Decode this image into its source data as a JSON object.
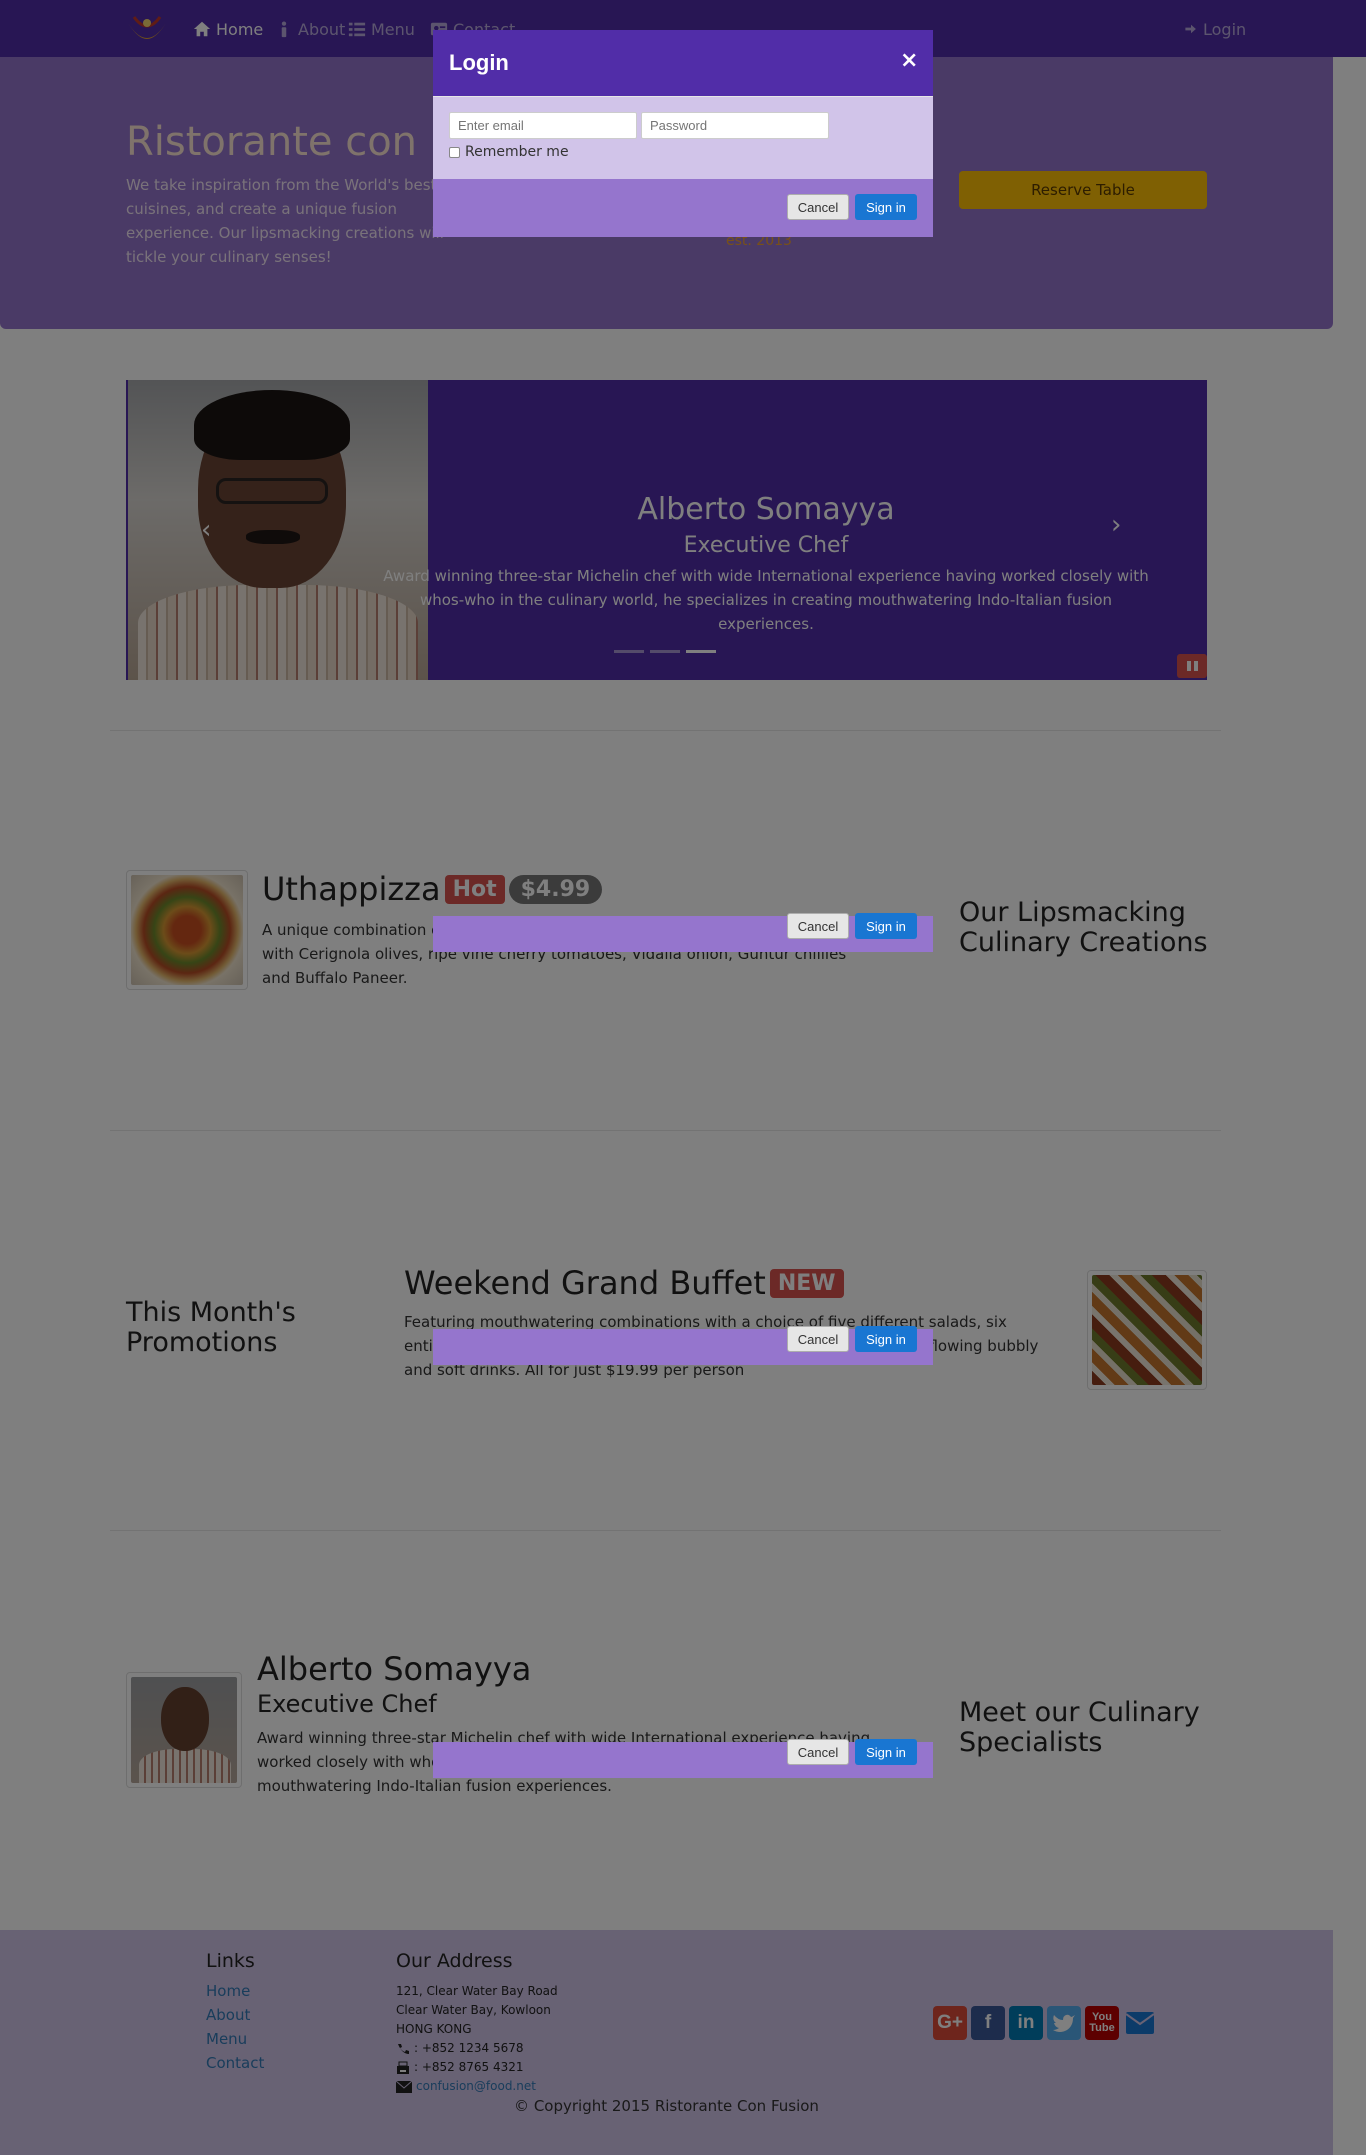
{
  "navbar": {
    "items": [
      {
        "label": "Home",
        "icon": "home-icon",
        "active": true
      },
      {
        "label": "About",
        "icon": "info-icon",
        "active": false
      },
      {
        "label": "Menu",
        "icon": "list-icon",
        "active": false
      },
      {
        "label": "Contact",
        "icon": "address-card-icon",
        "active": false
      }
    ],
    "login_label": "Login"
  },
  "jumbotron": {
    "title": "Ristorante con Fusion",
    "text": "We take inspiration from the World's best cuisines, and create a unique fusion experience. Our lipsmacking creations will tickle your culinary senses!",
    "logo_text": "est. 2013",
    "reserve_label": "Reserve Table"
  },
  "carousel": {
    "name": "Alberto Somayya",
    "designation": "Executive Chef",
    "description": "Award winning three-star Michelin chef with wide International experience having worked closely with whos-who in the culinary world, he specializes in creating mouthwatering Indo-Italian fusion experiences.",
    "active_slide": 3,
    "slide_count": 3
  },
  "dish": {
    "name": "Uthappizza",
    "label": "Hot",
    "price": "$4.99",
    "description": "A unique combination of Indian Uthappam (pancake) and Italian pizza, topped with Cerignola olives, ripe vine cherry tomatoes, Vidalia onion, Guntur chillies and Buffalo Paneer.",
    "side_heading": "Our Lipsmacking Culinary Creations"
  },
  "promotion": {
    "name": "Weekend Grand Buffet",
    "label": "NEW",
    "description": "Featuring mouthwatering combinations with a choice of five different salads, six enticing appetizers, six main entrees and five choicest desserts. Free flowing bubbly and soft drinks. All for just $19.99 per person",
    "side_heading": "This Month's Promotions"
  },
  "leader": {
    "name": "Alberto Somayya",
    "designation": "Executive Chef",
    "description": "Award winning three-star Michelin chef with wide International experience having worked closely with whos-who in the culinary world, he specializes in creating mouthwatering Indo-Italian fusion experiences.",
    "side_heading": "Meet our Culinary Specialists"
  },
  "footer": {
    "links_heading": "Links",
    "links": [
      "Home",
      "About",
      "Menu",
      "Contact"
    ],
    "address_heading": "Our Address",
    "address_lines": [
      "121, Clear Water Bay Road",
      "Clear Water Bay, Kowloon",
      "HONG KONG"
    ],
    "phone": ": +852 1234 5678",
    "fax": ": +852 8765 4321",
    "email": "confusion@food.net",
    "social": [
      "google-plus-icon",
      "facebook-icon",
      "linkedin-icon",
      "twitter-icon",
      "youtube-icon",
      "mail-icon"
    ],
    "copyright": "© Copyright 2015 Ristorante Con Fusion"
  },
  "modal": {
    "title": "Login",
    "close": "×",
    "email_placeholder": "Enter email",
    "password_placeholder": "Password",
    "remember_label": "Remember me",
    "cancel_label": "Cancel",
    "signin_label": "Sign in"
  },
  "colors": {
    "primary": "#512DA8",
    "primary_light": "#9575CD",
    "primary_lighter": "#D1C4E9",
    "accent": "#FFC107",
    "signin": "#1976D2",
    "danger": "#d9534f"
  }
}
